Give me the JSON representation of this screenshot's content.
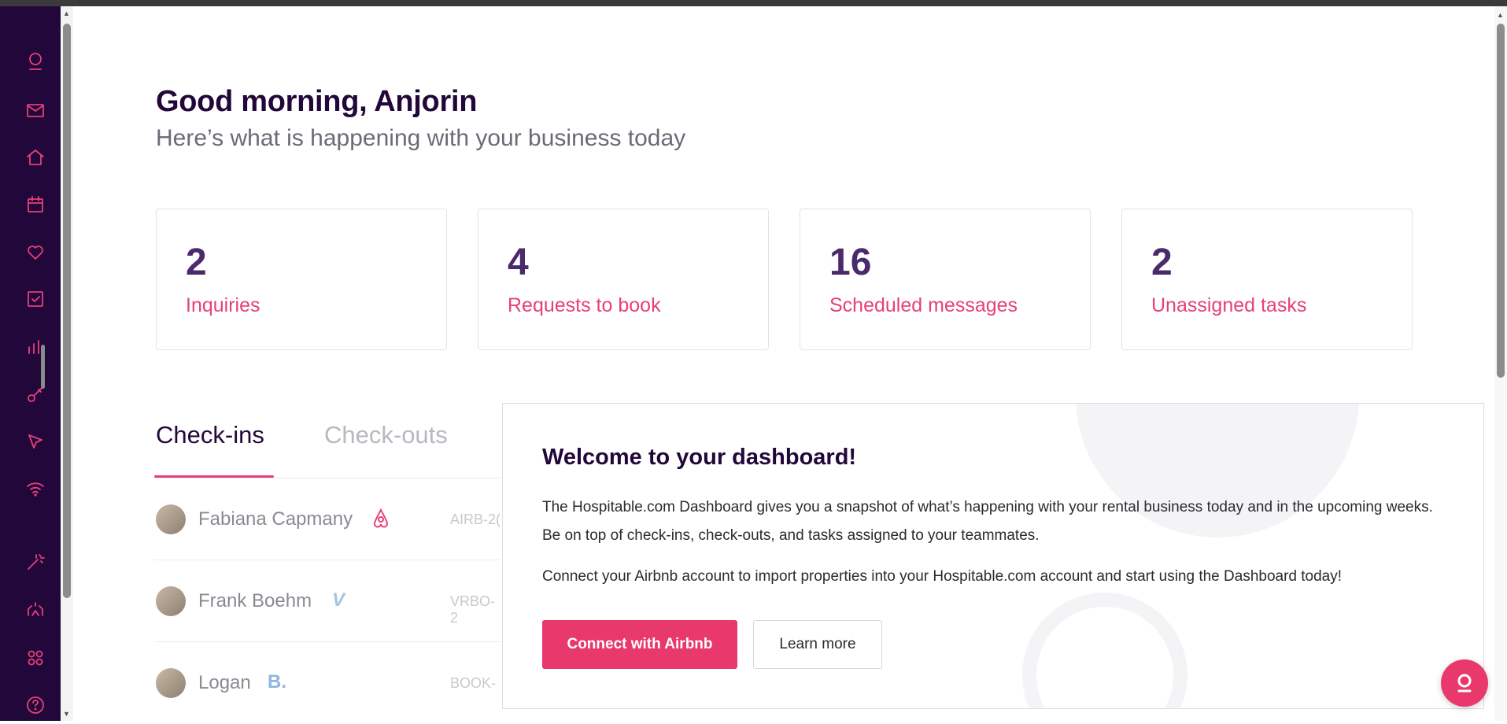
{
  "greeting": "Good morning, Anjorin",
  "subtitle": "Here’s what is happening with your business today",
  "stats": [
    {
      "value": "2",
      "label": "Inquiries"
    },
    {
      "value": "4",
      "label": "Requests to book"
    },
    {
      "value": "16",
      "label": "Scheduled messages"
    },
    {
      "value": "2",
      "label": "Unassigned tasks"
    }
  ],
  "tabs": {
    "active": "Check-ins",
    "inactive": "Check-outs"
  },
  "checkins": [
    {
      "name": "Fabiana Capmany",
      "source": "airbnb-icon",
      "code": "AIRB-2("
    },
    {
      "name": "Frank Boehm",
      "source": "vrbo-icon",
      "source_text": "V",
      "code": "VRBO-2"
    },
    {
      "name": "Logan",
      "source": "booking-icon",
      "source_text": "B.",
      "code": "BOOK-"
    }
  ],
  "welcome": {
    "title": "Welcome to your dashboard!",
    "p1": "The Hospitable.com Dashboard gives you a snapshot of what’s happening with your rental business today and in the upcoming weeks. Be on top of check-ins, check-outs, and tasks assigned to your teammates.",
    "p2": "Connect your Airbnb account to import properties into your Hospitable.com account and start using the Dashboard today!",
    "primary_button": "Connect with Airbnb",
    "secondary_button": "Learn more"
  },
  "colors": {
    "brand": "#e8386c",
    "sidebar": "#22073a",
    "heading": "#22073a"
  }
}
